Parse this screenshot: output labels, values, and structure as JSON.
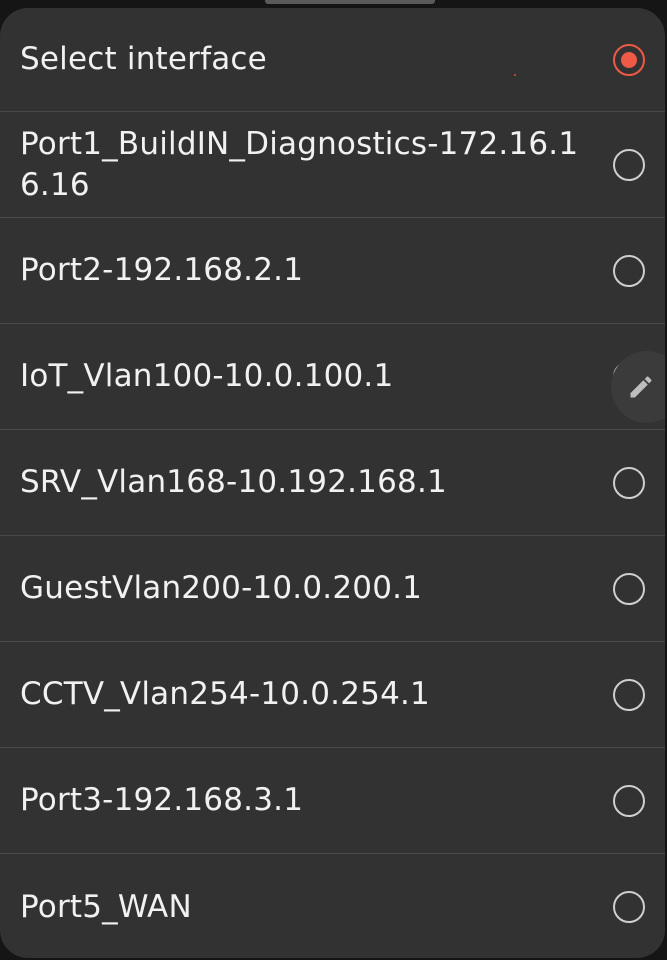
{
  "dialog": {
    "title": "Select interface",
    "title_selected": true,
    "options": [
      {
        "label": "Port1_BuildIN_Diagnostics-172.16.16.16",
        "selected": false
      },
      {
        "label": "Port2-192.168.2.1",
        "selected": false
      },
      {
        "label": "IoT_Vlan100-10.0.100.1",
        "selected": false
      },
      {
        "label": "SRV_Vlan168-10.192.168.1",
        "selected": false
      },
      {
        "label": "GuestVlan200-10.0.200.1",
        "selected": false
      },
      {
        "label": "CCTV_Vlan254-10.0.254.1",
        "selected": false
      },
      {
        "label": "Port3-192.168.3.1",
        "selected": false
      },
      {
        "label": "Port5_WAN",
        "selected": false
      }
    ]
  },
  "icons": {
    "edit": "pencil-icon",
    "radio": "radio-icon"
  },
  "colors": {
    "dialog_background": "#333232",
    "divider": "#4a4949",
    "text": "#f1f1f1",
    "radio_unchecked": "#cfcfcf",
    "accent": "#ee5a45"
  }
}
